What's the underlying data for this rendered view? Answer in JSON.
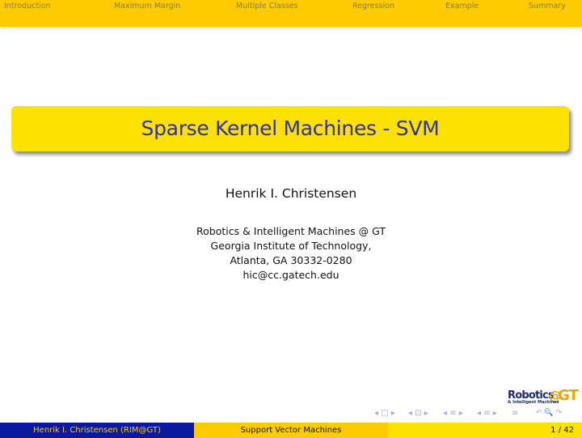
{
  "headline": {
    "sections": [
      "Introduction",
      "Maximum Margin",
      "Multiple Classes",
      "Regression",
      "Example",
      "Summary"
    ]
  },
  "title": "Sparse Kernel Machines - SVM",
  "author": "Henrik I. Christensen",
  "institute": {
    "line1": "Robotics & Intelligent Machines @ GT",
    "line2": "Georgia Institute of Technology,",
    "line3": "Atlanta, GA 30332-0280",
    "email": "hic@cc.gatech.edu"
  },
  "logo": {
    "robotics": "Robotics",
    "at": "@",
    "gt": "GT",
    "sub": "& Intelligent Machines"
  },
  "nav_symbols": {
    "frame": "◂ □ ▸",
    "subsection": "◂ ⊡ ▸",
    "section": "◂ ≡ ▸",
    "subsec2": "◂ ≡ ▸",
    "align": "≡",
    "search": "↶ 🔍 ↷"
  },
  "footer": {
    "author": "Henrik I. Christensen  (RIM@GT)",
    "title": "Support Vector Machines",
    "page": "1 / 42"
  },
  "colors": {
    "headline_bg": "#fecb00",
    "title_box_bg": "#fde100",
    "title_text": "#3030a0",
    "footer_left_bg": "#0a1aa0"
  }
}
